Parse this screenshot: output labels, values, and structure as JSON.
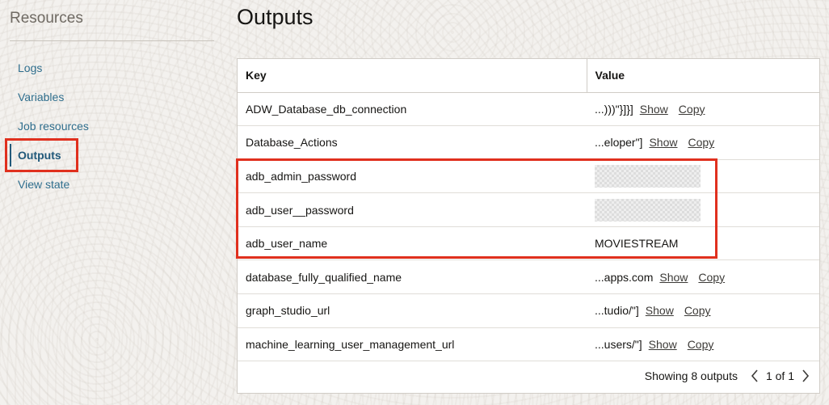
{
  "sidebar": {
    "title": "Resources",
    "items": [
      {
        "label": "Logs",
        "active": false
      },
      {
        "label": "Variables",
        "active": false
      },
      {
        "label": "Job resources",
        "active": false
      },
      {
        "label": "Outputs",
        "active": true
      },
      {
        "label": "View state",
        "active": false
      }
    ]
  },
  "main": {
    "title": "Outputs",
    "table": {
      "headers": {
        "key": "Key",
        "value": "Value"
      },
      "actions": {
        "show": "Show",
        "copy": "Copy"
      },
      "rows": [
        {
          "key": "ADW_Database_db_connection",
          "value": "...)))\"}]}]",
          "masked": false,
          "has_actions": true
        },
        {
          "key": "Database_Actions",
          "value": "...eloper\"]",
          "masked": false,
          "has_actions": true
        },
        {
          "key": "adb_admin_password",
          "value": "",
          "masked": true,
          "has_actions": false
        },
        {
          "key": "adb_user__password",
          "value": "",
          "masked": true,
          "has_actions": false
        },
        {
          "key": "adb_user_name",
          "value": "MOVIESTREAM",
          "masked": false,
          "has_actions": false
        },
        {
          "key": "database_fully_qualified_name",
          "value": "...apps.com",
          "masked": false,
          "has_actions": true
        },
        {
          "key": "graph_studio_url",
          "value": "...tudio/\"]",
          "masked": false,
          "has_actions": true
        },
        {
          "key": "machine_learning_user_management_url",
          "value": "...users/\"]",
          "masked": false,
          "has_actions": true
        }
      ]
    },
    "footer": {
      "showing": "Showing 8 outputs",
      "page_text": "1 of 1"
    }
  },
  "colors": {
    "link": "#2f6e8d",
    "annotation": "#e0301e",
    "background": "#f3f1ee"
  }
}
